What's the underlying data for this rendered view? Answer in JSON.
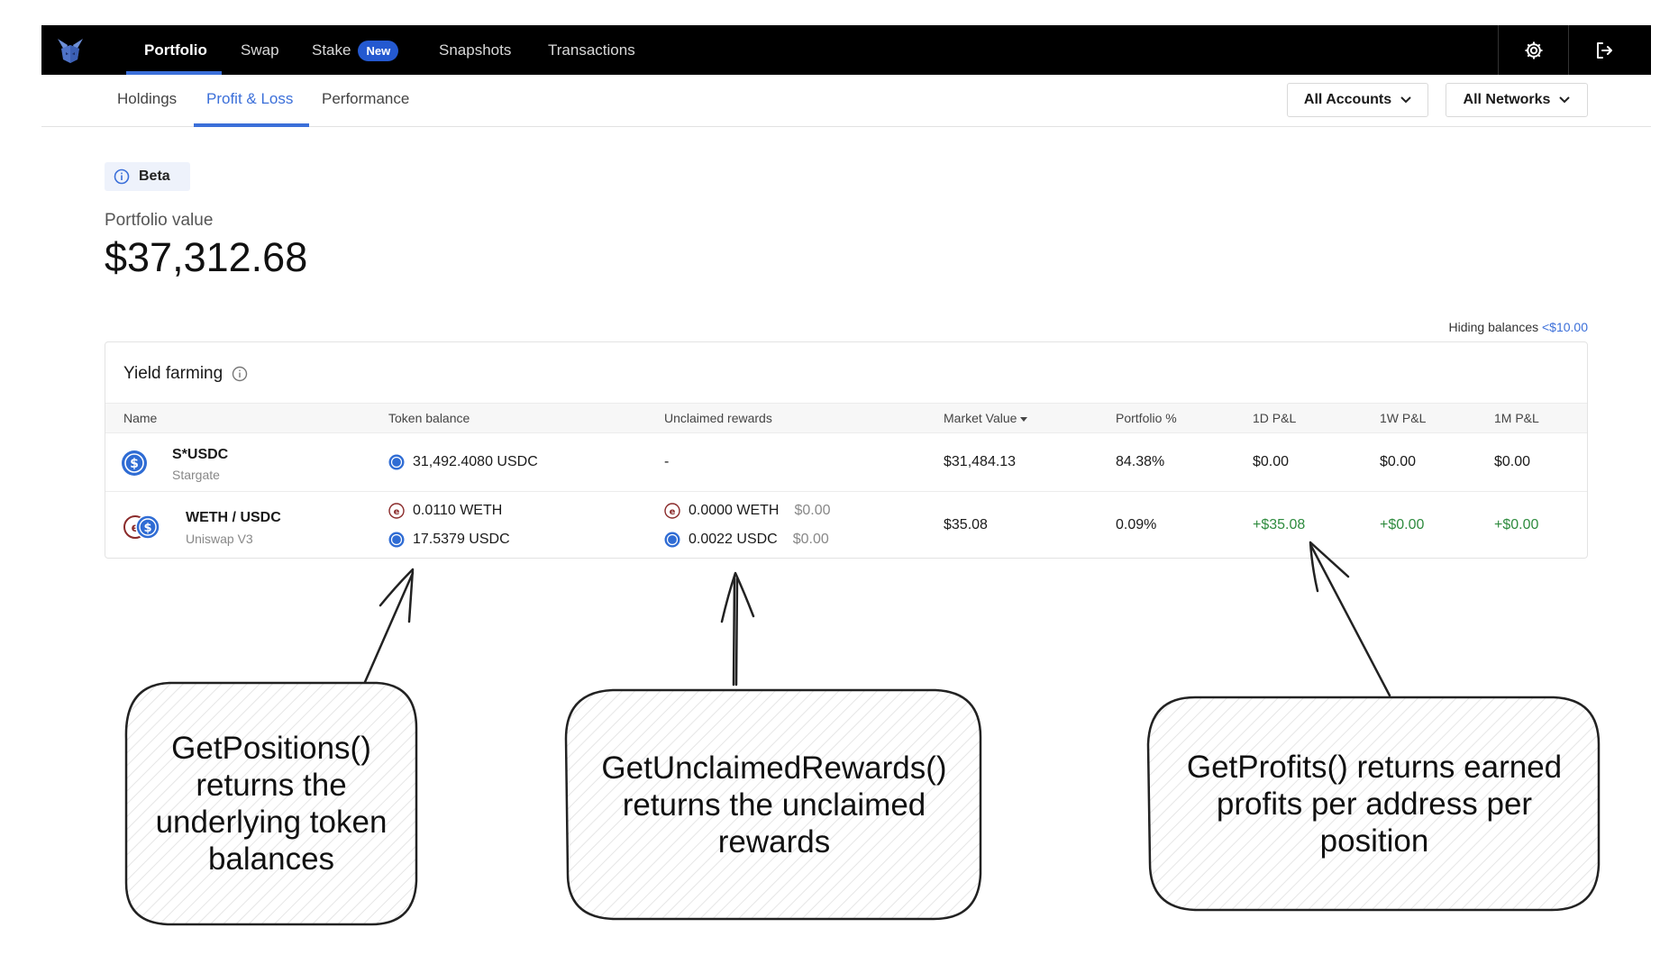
{
  "nav": {
    "items": [
      {
        "label": "Portfolio",
        "active": true
      },
      {
        "label": "Swap",
        "active": false
      },
      {
        "label": "Stake",
        "badge": "New",
        "active": false
      },
      {
        "label": "Snapshots",
        "active": false
      },
      {
        "label": "Transactions",
        "active": false
      }
    ],
    "icons": [
      "gear-icon",
      "logout-icon"
    ]
  },
  "subnav": {
    "tabs": [
      {
        "label": "Holdings"
      },
      {
        "label": "Profit & Loss",
        "active": true
      },
      {
        "label": "Performance"
      }
    ],
    "accounts_dropdown": "All Accounts",
    "networks_dropdown": "All Networks"
  },
  "beta_label": "Beta",
  "portfolio": {
    "label": "Portfolio value",
    "value": "$37,312.68"
  },
  "hiding": {
    "text": "Hiding balances",
    "threshold": "<$10.00"
  },
  "yield_farming": {
    "title": "Yield farming",
    "columns": [
      "Name",
      "Token balance",
      "Unclaimed rewards",
      "Market Value",
      "Portfolio %",
      "1D P&L",
      "1W P&L",
      "1M P&L"
    ],
    "rows": [
      {
        "name": "S*USDC",
        "protocol": "Stargate",
        "balances": [
          "31,492.4080 USDC"
        ],
        "rewards": "-",
        "market_value": "$31,484.13",
        "portfolio_pct": "84.38%",
        "pnl_1d": "$0.00",
        "pnl_1w": "$0.00",
        "pnl_1m": "$0.00"
      },
      {
        "name": "WETH / USDC",
        "protocol": "Uniswap V3",
        "balances": [
          "0.0110 WETH",
          "17.5379 USDC"
        ],
        "rewards": [
          {
            "amount": "0.0000 WETH",
            "usd": "$0.00"
          },
          {
            "amount": "0.0022 USDC",
            "usd": "$0.00"
          }
        ],
        "market_value": "$35.08",
        "portfolio_pct": "0.09%",
        "pnl_1d": "+$35.08",
        "pnl_1w": "+$0.00",
        "pnl_1m": "+$0.00"
      }
    ]
  },
  "annotations": {
    "positions": "GetPositions() returns the underlying token balances",
    "rewards": "GetUnclaimedRewards() returns the unclaimed rewards",
    "profits": "GetProfits() returns earned profits per address per position"
  },
  "colors": {
    "accent": "#3b6fd9",
    "profit": "#2e8b3e",
    "nav_bg": "#000000"
  }
}
